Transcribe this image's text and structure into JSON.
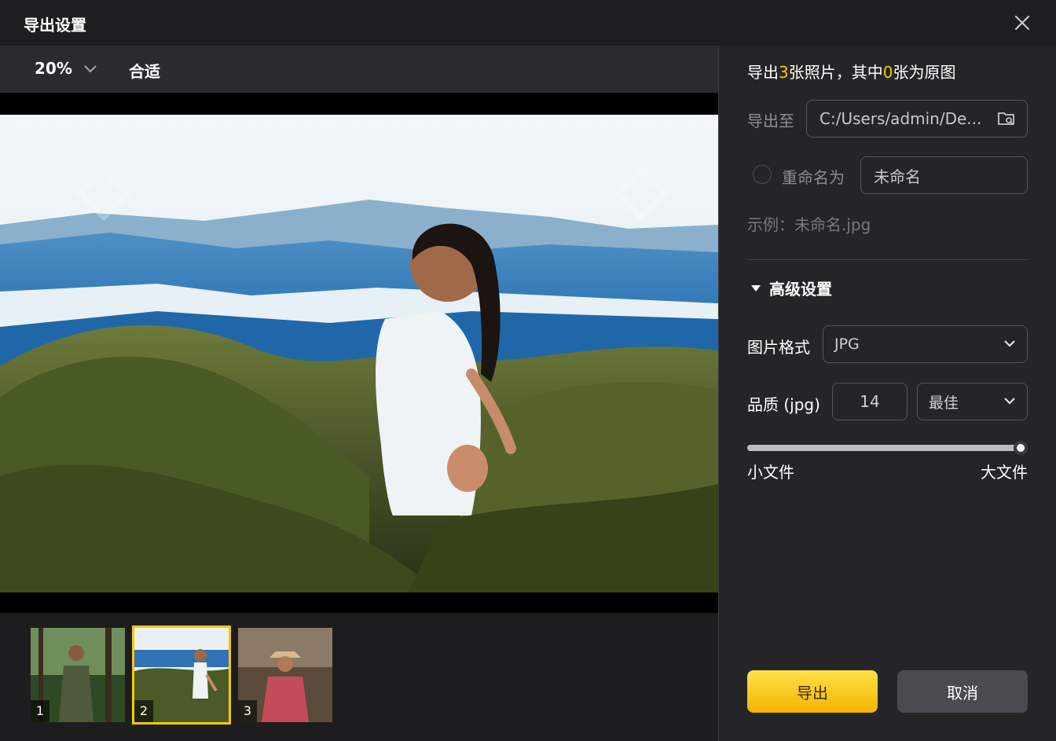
{
  "window": {
    "title": "导出设置"
  },
  "toolbar": {
    "zoom": "20%",
    "fit_label": "合适"
  },
  "thumbnails": [
    {
      "number": "1",
      "selected": false
    },
    {
      "number": "2",
      "selected": true
    },
    {
      "number": "3",
      "selected": false
    }
  ],
  "summary": {
    "prefix": "导出",
    "count": "3",
    "middle": "张照片，其中",
    "original_count": "0",
    "suffix": "张为原图"
  },
  "export_to": {
    "label": "导出至",
    "path": "C:/Users/admin/De..."
  },
  "rename": {
    "label": "重命名为",
    "value": "未命名",
    "checked": false
  },
  "example": {
    "text": "示例：未命名.jpg"
  },
  "advanced": {
    "label": "高级设置"
  },
  "format": {
    "label": "图片格式",
    "value": "JPG"
  },
  "quality": {
    "label": "品质 (jpg)",
    "value": "14",
    "preset": "最佳",
    "slider_fraction": 1.0,
    "min_label": "小文件",
    "max_label": "大文件"
  },
  "buttons": {
    "export": "导出",
    "cancel": "取消"
  },
  "colors": {
    "accent": "#f7c800",
    "background": "#1f1f21",
    "panel": "#252528"
  }
}
